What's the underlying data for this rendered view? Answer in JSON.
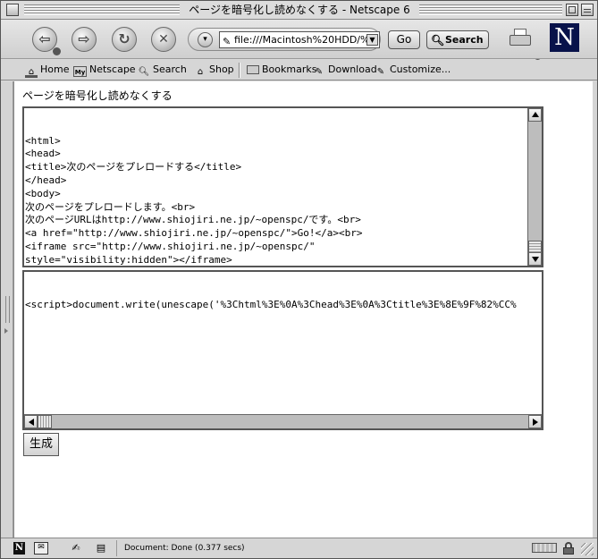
{
  "window": {
    "title": "ページを暗号化し読めなくする - Netscape 6"
  },
  "toolbar": {
    "back_icon": "back-arrow-icon",
    "forward_icon": "forward-arrow-icon",
    "reload_icon": "reload-icon",
    "stop_icon": "stop-icon",
    "url_value": "file:///Macintosh%20HDD/%9",
    "go_label": "Go",
    "search_label": "Search"
  },
  "personal_toolbar": {
    "items": [
      {
        "label": "Home"
      },
      {
        "label": "Netscape"
      },
      {
        "label": "Search"
      },
      {
        "label": "Shop"
      },
      {
        "label": "Bookmarks"
      },
      {
        "label": "Download"
      },
      {
        "label": "Customize..."
      }
    ]
  },
  "page": {
    "heading": "ページを暗号化し読めなくする",
    "source_text": "<html>\n<head>\n<title>次のページをプレロードする</title>\n</head>\n<body>\n次のページをプレロードします。<br>\n次のページURLはhttp://www.shiojiri.ne.jp/~openspc/です。<br>\n<a href=\"http://www.shiojiri.ne.jp/~openspc/\">Go!</a><br>\n<iframe src=\"http://www.shiojiri.ne.jp/~openspc/\"\nstyle=\"visibility:hidden\"></iframe>\n</body>\n</html>",
    "output_text": "<script>document.write(unescape('%3Chtml%3E%0A%3Chead%3E%0A%3Ctitle%3E%8E%9F%82%CC%",
    "generate_label": "生成"
  },
  "statusbar": {
    "text": "Document: Done (0.377 secs)"
  }
}
